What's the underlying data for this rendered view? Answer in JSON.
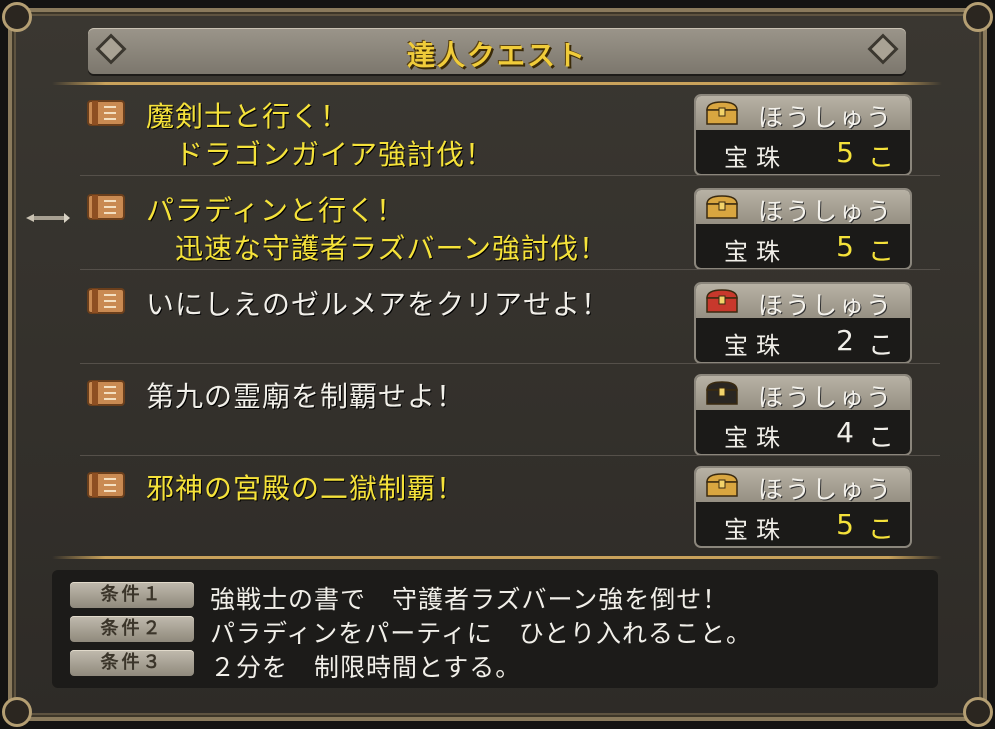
{
  "header": {
    "title": "達人クエスト"
  },
  "quests": [
    {
      "line1": "魔剣士と行く！",
      "line2": "　ドラゴンガイア強討伐！",
      "color": "yellow",
      "reward": {
        "label": "ほうしゅう",
        "item": "宝珠",
        "count": "5",
        "unit": "こ",
        "chest": "gold"
      }
    },
    {
      "line1": "パラディンと行く！",
      "line2": "　迅速な守護者ラズバーン強討伐！",
      "color": "yellow",
      "reward": {
        "label": "ほうしゅう",
        "item": "宝珠",
        "count": "5",
        "unit": "こ",
        "chest": "gold"
      }
    },
    {
      "line1": "いにしえのゼルメアをクリアせよ！",
      "line2": "",
      "color": "white",
      "reward": {
        "label": "ほうしゅう",
        "item": "宝珠",
        "count": "2",
        "unit": "こ",
        "chest": "red"
      }
    },
    {
      "line1": "第九の霊廟を制覇せよ！",
      "line2": "",
      "color": "white",
      "reward": {
        "label": "ほうしゅう",
        "item": "宝珠",
        "count": "4",
        "unit": "こ",
        "chest": "black"
      }
    },
    {
      "line1": "邪神の宮殿の二獄制覇！",
      "line2": "",
      "color": "yellow",
      "reward": {
        "label": "ほうしゅう",
        "item": "宝珠",
        "count": "5",
        "unit": "こ",
        "chest": "gold"
      }
    }
  ],
  "conditions": [
    {
      "badge": "条件１",
      "text": "強戦士の書で　守護者ラズバーン強を倒せ！"
    },
    {
      "badge": "条件２",
      "text": "パラディンをパーティに　ひとり入れること。"
    },
    {
      "badge": "条件３",
      "text": "２分を　制限時間とする。"
    }
  ],
  "colors": {
    "yellow": "#f5e23a",
    "white": "#f1efe9",
    "gold_chest": "#d9a640",
    "red_chest": "#c8382c",
    "black_chest": "#2a2622"
  }
}
